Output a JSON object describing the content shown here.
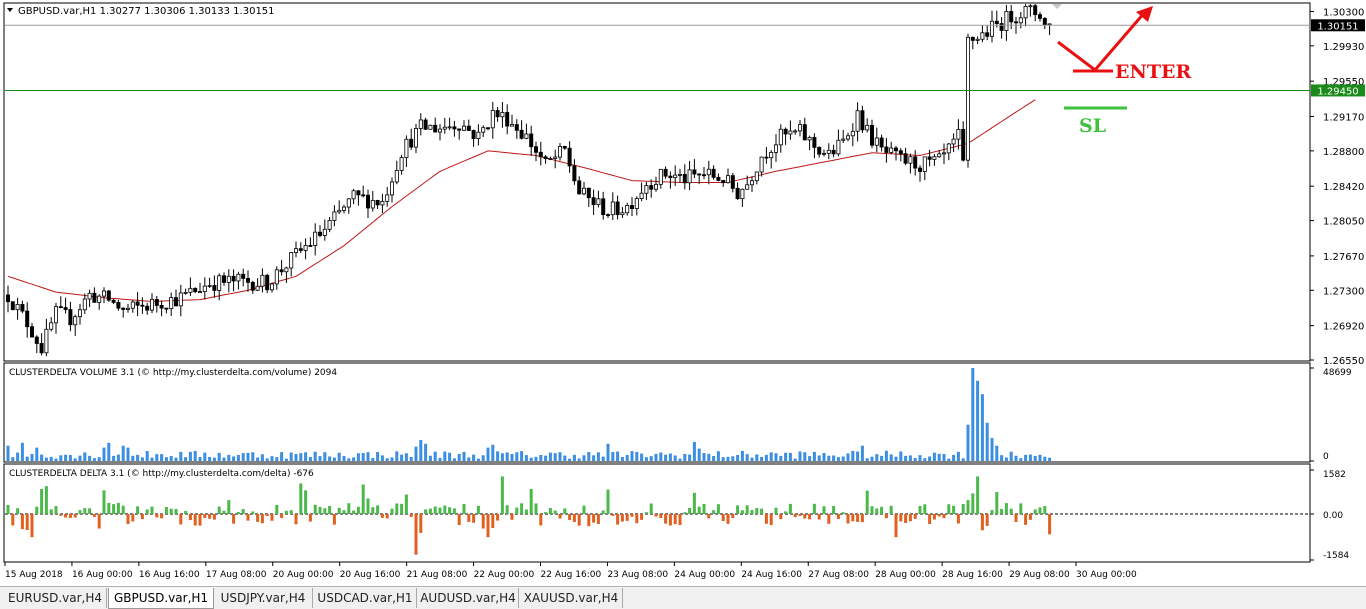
{
  "chart_data": [
    {
      "type": "candlestick",
      "title": "GBPUSD.var,H1  1.30277 1.30306 1.30133 1.30151",
      "y_ticks": [
        "1.30300",
        "1.29930",
        "1.29550",
        "1.29170",
        "1.28800",
        "1.28420",
        "1.28050",
        "1.27670",
        "1.27300",
        "1.26920",
        "1.26550"
      ],
      "ylim": [
        1.2655,
        1.3038
      ],
      "current_price": 1.30151,
      "current_price_label": "1.30151",
      "stop_loss": 1.2945,
      "stop_loss_label": "1.29450",
      "moving_average": "red",
      "x_ticks": [
        "15 Aug 2018",
        "16 Aug 00:00",
        "16 Aug 16:00",
        "17 Aug 08:00",
        "20 Aug 00:00",
        "20 Aug 16:00",
        "21 Aug 08:00",
        "22 Aug 00:00",
        "22 Aug 16:00",
        "23 Aug 08:00",
        "24 Aug 00:00",
        "24 Aug 16:00",
        "27 Aug 08:00",
        "28 Aug 00:00",
        "28 Aug 16:00",
        "29 Aug 08:00",
        "30 Aug 00:00"
      ],
      "price_path": [
        [
          0,
          1.2725
        ],
        [
          4,
          1.2695
        ],
        [
          7,
          1.2668
        ],
        [
          10,
          1.2705
        ],
        [
          13,
          1.27
        ],
        [
          17,
          1.2725
        ],
        [
          21,
          1.272
        ],
        [
          24,
          1.2708
        ],
        [
          30,
          1.2715
        ],
        [
          36,
          1.2722
        ],
        [
          42,
          1.2738
        ],
        [
          48,
          1.274
        ],
        [
          54,
          1.2738
        ],
        [
          60,
          1.2768
        ],
        [
          66,
          1.2795
        ],
        [
          72,
          1.283
        ],
        [
          78,
          1.2825
        ],
        [
          82,
          1.288
        ],
        [
          86,
          1.2905
        ],
        [
          90,
          1.2905
        ],
        [
          94,
          1.291
        ],
        [
          98,
          1.2895
        ],
        [
          101,
          1.292
        ],
        [
          104,
          1.2915
        ],
        [
          108,
          1.2895
        ],
        [
          112,
          1.2865
        ],
        [
          116,
          1.288
        ],
        [
          119,
          1.2835
        ],
        [
          122,
          1.2825
        ],
        [
          125,
          1.2815
        ],
        [
          129,
          1.282
        ],
        [
          133,
          1.2845
        ],
        [
          137,
          1.2855
        ],
        [
          141,
          1.285
        ],
        [
          145,
          1.2855
        ],
        [
          149,
          1.285
        ],
        [
          152,
          1.2835
        ],
        [
          154,
          1.2845
        ],
        [
          157,
          1.2875
        ],
        [
          161,
          1.2895
        ],
        [
          165,
          1.29
        ],
        [
          168,
          1.2885
        ],
        [
          171,
          1.2875
        ],
        [
          174,
          1.289
        ],
        [
          177,
          1.292
        ],
        [
          179,
          1.29
        ],
        [
          182,
          1.288
        ],
        [
          186,
          1.287
        ],
        [
          190,
          1.2865
        ],
        [
          194,
          1.2868
        ],
        [
          196,
          1.288
        ],
        [
          198,
          1.2895
        ],
        [
          200,
          1.2998
        ],
        [
          203,
          1.3005
        ],
        [
          206,
          1.3015
        ],
        [
          209,
          1.3025
        ],
        [
          212,
          1.303
        ],
        [
          215,
          1.3028
        ],
        [
          216,
          1.3015
        ]
      ],
      "ma_path": [
        [
          0,
          1.2745
        ],
        [
          10,
          1.2728
        ],
        [
          20,
          1.2722
        ],
        [
          30,
          1.2718
        ],
        [
          40,
          1.272
        ],
        [
          50,
          1.273
        ],
        [
          60,
          1.2745
        ],
        [
          70,
          1.2778
        ],
        [
          80,
          1.282
        ],
        [
          90,
          1.2858
        ],
        [
          100,
          1.288
        ],
        [
          110,
          1.2875
        ],
        [
          120,
          1.2862
        ],
        [
          130,
          1.2848
        ],
        [
          140,
          1.2846
        ],
        [
          150,
          1.2846
        ],
        [
          160,
          1.2858
        ],
        [
          170,
          1.2868
        ],
        [
          180,
          1.2878
        ],
        [
          190,
          1.2875
        ],
        [
          200,
          1.2888
        ],
        [
          208,
          1.2915
        ],
        [
          214,
          1.2935
        ]
      ],
      "annotations": {
        "enter": "ENTER",
        "stop_loss": "SL"
      },
      "colors": {
        "bull": "#000000",
        "bear": "#000000",
        "ma": "#c01818",
        "stop_loss": "#1a8a1a",
        "annotation_arrow": "#e81010",
        "sl_text": "#3ec23e"
      }
    },
    {
      "type": "bar",
      "title": "CLUSTERDELTA VOLUME 3.1 (© http://my.clusterdelta.com/volume) 2094",
      "y_ticks": [
        "48699",
        "0"
      ],
      "ylim": [
        0,
        48699
      ],
      "color": "#3c8ee0",
      "spikes": [
        [
          0,
          8000
        ],
        [
          3,
          9500
        ],
        [
          6,
          7000
        ],
        [
          20,
          7000
        ],
        [
          21,
          9500
        ],
        [
          24,
          8000
        ],
        [
          25,
          7000
        ],
        [
          85,
          7500
        ],
        [
          86,
          11000
        ],
        [
          87,
          9000
        ],
        [
          100,
          7000
        ],
        [
          101,
          8500
        ],
        [
          125,
          9000
        ],
        [
          143,
          10000
        ],
        [
          144,
          6500
        ],
        [
          178,
          8000
        ],
        [
          200,
          19000
        ],
        [
          201,
          48699
        ],
        [
          202,
          42000
        ],
        [
          203,
          35000
        ],
        [
          204,
          20000
        ],
        [
          205,
          12000
        ],
        [
          206,
          8000
        ]
      ]
    },
    {
      "type": "bar",
      "title": "CLUSTERDELTA DELTA 3.1 (© http://my.clusterdelta.com/delta) -676",
      "y_ticks": [
        "1582",
        "0.00",
        "-1584"
      ],
      "ylim": [
        -1584,
        1582
      ],
      "colors": {
        "positive": "#4cb84c",
        "negative": "#e06020"
      },
      "spikes": [
        [
          3,
          -520
        ],
        [
          4,
          -550
        ],
        [
          5,
          -800
        ],
        [
          7,
          900
        ],
        [
          8,
          1000
        ],
        [
          19,
          -500
        ],
        [
          20,
          850
        ],
        [
          21,
          400
        ],
        [
          23,
          400
        ],
        [
          40,
          -400
        ],
        [
          46,
          500
        ],
        [
          53,
          -320
        ],
        [
          61,
          1100
        ],
        [
          62,
          850
        ],
        [
          74,
          1060
        ],
        [
          75,
          560
        ],
        [
          83,
          700
        ],
        [
          85,
          -1400
        ],
        [
          86,
          -650
        ],
        [
          99,
          -500
        ],
        [
          100,
          -800
        ],
        [
          101,
          -480
        ],
        [
          103,
          1350
        ],
        [
          109,
          900
        ],
        [
          119,
          -400
        ],
        [
          121,
          -420
        ],
        [
          125,
          880
        ],
        [
          143,
          760
        ],
        [
          178,
          -280
        ],
        [
          179,
          840
        ],
        [
          185,
          -800
        ],
        [
          200,
          500
        ],
        [
          201,
          740
        ],
        [
          202,
          1350
        ],
        [
          203,
          -560
        ],
        [
          204,
          -410
        ],
        [
          206,
          790
        ],
        [
          217,
          -700
        ]
      ]
    }
  ],
  "tabs": [
    {
      "label": "EURUSD.var,H4",
      "active": false
    },
    {
      "label": "GBPUSD.var,H1",
      "active": true
    },
    {
      "label": "USDJPY.var,H4",
      "active": false
    },
    {
      "label": "USDCAD.var,H1",
      "active": false
    },
    {
      "label": "AUDUSD.var,H4",
      "active": false
    },
    {
      "label": "XAUUSD.var,H4",
      "active": false
    }
  ]
}
